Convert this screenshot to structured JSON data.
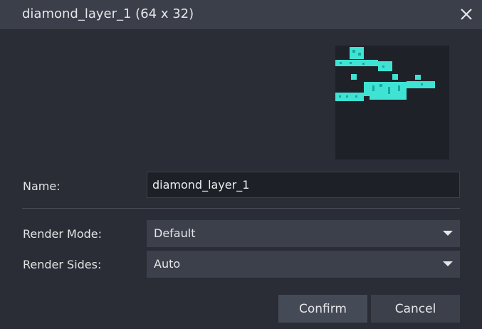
{
  "window": {
    "title": "diamond_layer_1 (64 x 32)",
    "close_icon": "close-icon"
  },
  "preview": {
    "icon": "texture-preview",
    "pixel_color": "#3fe3d3",
    "pixel_dark": "#1aa89c",
    "background": "#1f2128"
  },
  "form": {
    "name_label": "Name:",
    "name_value": "diamond_layer_1",
    "render_mode_label": "Render Mode:",
    "render_mode_value": "Default",
    "render_sides_label": "Render Sides:",
    "render_sides_value": "Auto"
  },
  "buttons": {
    "confirm": "Confirm",
    "cancel": "Cancel"
  },
  "colors": {
    "accent": "#3fe3d3",
    "background": "#2a2d35",
    "titlebar": "#3b3f4a"
  }
}
